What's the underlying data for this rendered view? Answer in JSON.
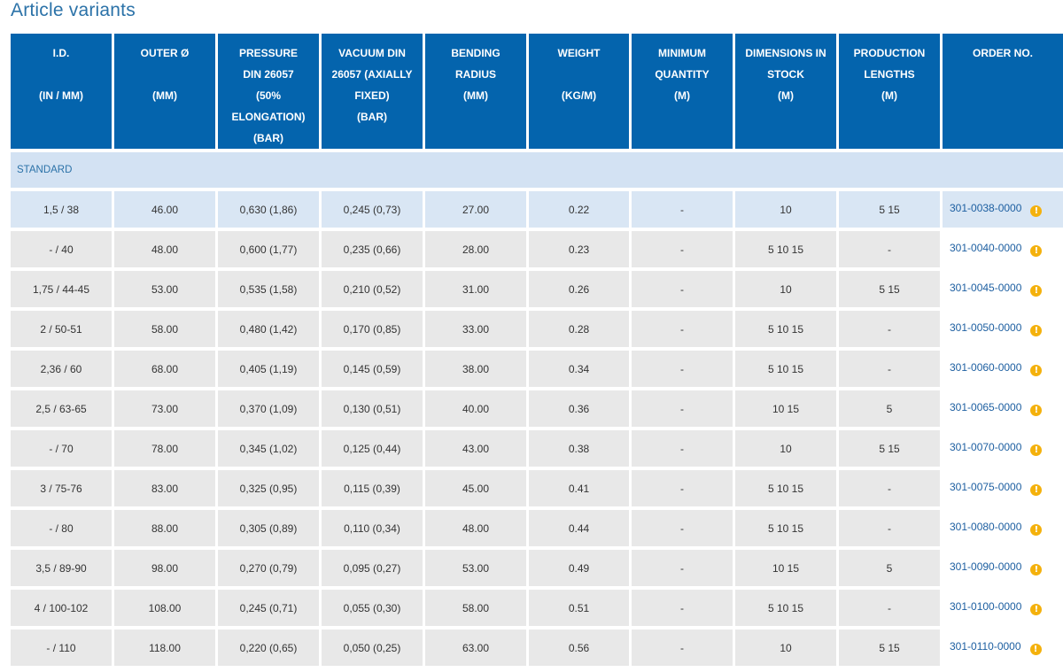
{
  "page_title": "Article variants",
  "headers": [
    {
      "top": "I.D.",
      "unit": "(IN / MM)"
    },
    {
      "top": "OUTER Ø",
      "unit": "(MM)"
    },
    {
      "top": "PRESSURE DIN 26057 (50% ELONGATION)",
      "unit": "(BAR)"
    },
    {
      "top": "VACUUM DIN 26057 (AXIALLY FIXED)",
      "unit": "(BAR)"
    },
    {
      "top": "BENDING RADIUS",
      "unit": "(MM)"
    },
    {
      "top": "WEIGHT",
      "unit": "(KG/M)"
    },
    {
      "top": "MINIMUM QUANTITY",
      "unit": "(M)"
    },
    {
      "top": "DIMENSIONS IN STOCK",
      "unit": "(M)"
    },
    {
      "top": "PRODUCTION LENGTHS",
      "unit": "(M)"
    },
    {
      "top": "ORDER NO.",
      "unit": ""
    }
  ],
  "section_label": "STANDARD",
  "rows": [
    {
      "id": "1,5 / 38",
      "outer": "46.00",
      "pressure": "0,630 (1,86)",
      "vacuum": "0,245 (0,73)",
      "radius": "27.00",
      "weight": "0.22",
      "min_qty": "-",
      "stock": "10",
      "prod": "5 15",
      "order": "301-0038-0000"
    },
    {
      "id": "- / 40",
      "outer": "48.00",
      "pressure": "0,600 (1,77)",
      "vacuum": "0,235 (0,66)",
      "radius": "28.00",
      "weight": "0.23",
      "min_qty": "-",
      "stock": "5 10 15",
      "prod": "-",
      "order": "301-0040-0000"
    },
    {
      "id": "1,75 / 44-45",
      "outer": "53.00",
      "pressure": "0,535 (1,58)",
      "vacuum": "0,210 (0,52)",
      "radius": "31.00",
      "weight": "0.26",
      "min_qty": "-",
      "stock": "10",
      "prod": "5 15",
      "order": "301-0045-0000"
    },
    {
      "id": "2 / 50-51",
      "outer": "58.00",
      "pressure": "0,480 (1,42)",
      "vacuum": "0,170 (0,85)",
      "radius": "33.00",
      "weight": "0.28",
      "min_qty": "-",
      "stock": "5 10 15",
      "prod": "-",
      "order": "301-0050-0000"
    },
    {
      "id": "2,36 / 60",
      "outer": "68.00",
      "pressure": "0,405 (1,19)",
      "vacuum": "0,145 (0,59)",
      "radius": "38.00",
      "weight": "0.34",
      "min_qty": "-",
      "stock": "5 10 15",
      "prod": "-",
      "order": "301-0060-0000"
    },
    {
      "id": "2,5 / 63-65",
      "outer": "73.00",
      "pressure": "0,370 (1,09)",
      "vacuum": "0,130 (0,51)",
      "radius": "40.00",
      "weight": "0.36",
      "min_qty": "-",
      "stock": "10 15",
      "prod": "5",
      "order": "301-0065-0000"
    },
    {
      "id": "- / 70",
      "outer": "78.00",
      "pressure": "0,345 (1,02)",
      "vacuum": "0,125 (0,44)",
      "radius": "43.00",
      "weight": "0.38",
      "min_qty": "-",
      "stock": "10",
      "prod": "5 15",
      "order": "301-0070-0000"
    },
    {
      "id": "3 / 75-76",
      "outer": "83.00",
      "pressure": "0,325 (0,95)",
      "vacuum": "0,115 (0,39)",
      "radius": "45.00",
      "weight": "0.41",
      "min_qty": "-",
      "stock": "5 10 15",
      "prod": "-",
      "order": "301-0075-0000"
    },
    {
      "id": "- / 80",
      "outer": "88.00",
      "pressure": "0,305 (0,89)",
      "vacuum": "0,110 (0,34)",
      "radius": "48.00",
      "weight": "0.44",
      "min_qty": "-",
      "stock": "5 10 15",
      "prod": "-",
      "order": "301-0080-0000"
    },
    {
      "id": "3,5 / 89-90",
      "outer": "98.00",
      "pressure": "0,270 (0,79)",
      "vacuum": "0,095 (0,27)",
      "radius": "53.00",
      "weight": "0.49",
      "min_qty": "-",
      "stock": "10 15",
      "prod": "5",
      "order": "301-0090-0000"
    },
    {
      "id": "4 / 100-102",
      "outer": "108.00",
      "pressure": "0,245 (0,71)",
      "vacuum": "0,055 (0,30)",
      "radius": "58.00",
      "weight": "0.51",
      "min_qty": "-",
      "stock": "5 10 15",
      "prod": "-",
      "order": "301-0100-0000"
    },
    {
      "id": "- / 110",
      "outer": "118.00",
      "pressure": "0,220 (0,65)",
      "vacuum": "0,050 (0,25)",
      "radius": "63.00",
      "weight": "0.56",
      "min_qty": "-",
      "stock": "10",
      "prod": "5 15",
      "order": "301-0110-0000"
    }
  ],
  "info_icon_glyph": "!",
  "colors": {
    "header_bg": "#0464ad",
    "section_bg": "#d3e2f3",
    "cell_bg": "#e8e8e8",
    "link": "#1d5fa1",
    "info_icon": "#f4b10c"
  }
}
